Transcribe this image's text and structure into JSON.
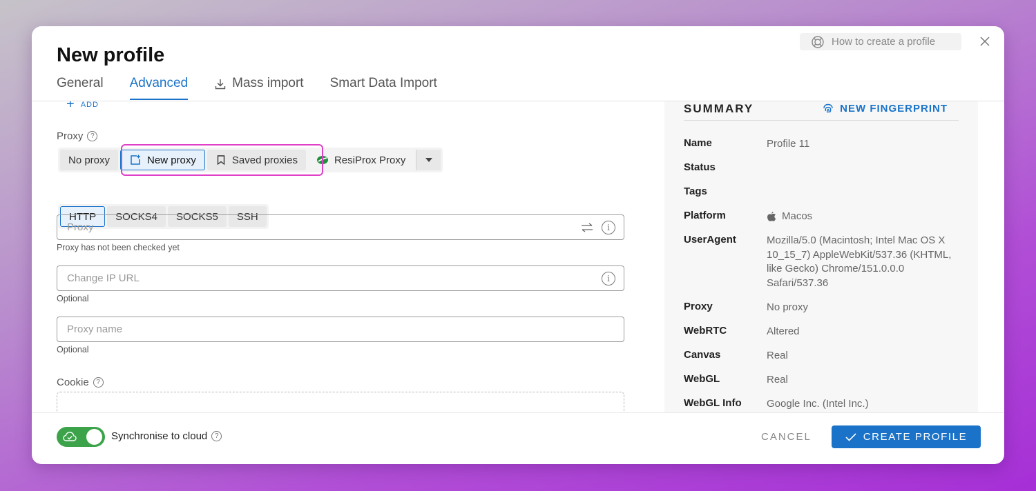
{
  "header": {
    "title": "New profile",
    "help_link": "How to create a profile"
  },
  "tabs": [
    {
      "label": "General"
    },
    {
      "label": "Advanced"
    },
    {
      "label": "Mass import"
    },
    {
      "label": "Smart Data Import"
    }
  ],
  "active_tab": "Advanced",
  "advanced": {
    "add_label": "ADD",
    "proxy_label": "Proxy",
    "proxy_modes": [
      "No proxy",
      "New proxy",
      "Saved proxies",
      "ResiProx Proxy"
    ],
    "active_proxy_mode": "New proxy",
    "protocols": [
      "HTTP",
      "SOCKS4",
      "SOCKS5",
      "SSH"
    ],
    "active_protocol": "HTTP",
    "proxy_field": {
      "placeholder": "Proxy",
      "hint": "Proxy has not been checked yet"
    },
    "change_ip_field": {
      "placeholder": "Change IP URL",
      "hint": "Optional"
    },
    "proxy_name_field": {
      "placeholder": "Proxy name",
      "hint": "Optional"
    },
    "cookie_label": "Cookie"
  },
  "summary": {
    "title": "SUMMARY",
    "fingerprint_button": "NEW FINGERPRINT",
    "rows": [
      {
        "key": "Name",
        "value": "Profile 11"
      },
      {
        "key": "Status",
        "value": ""
      },
      {
        "key": "Tags",
        "value": ""
      },
      {
        "key": "Platform",
        "value": "Macos"
      },
      {
        "key": "UserAgent",
        "value": "Mozilla/5.0 (Macintosh; Intel Mac OS X 10_15_7) AppleWebKit/537.36 (KHTML, like Gecko) Chrome/151.0.0.0 Safari/537.36"
      },
      {
        "key": "Proxy",
        "value": "No proxy"
      },
      {
        "key": "WebRTC",
        "value": "Altered"
      },
      {
        "key": "Canvas",
        "value": "Real"
      },
      {
        "key": "WebGL",
        "value": "Real"
      },
      {
        "key": "WebGL Info",
        "value": "Google Inc. (Intel Inc.)"
      }
    ]
  },
  "footer": {
    "sync_label": "Synchronise to cloud",
    "sync_enabled": true,
    "cancel_label": "CANCEL",
    "create_label": "CREATE PROFILE"
  },
  "colors": {
    "accent": "#1a73c9",
    "toggle_on": "#3ca34a",
    "highlight": "#e040c8"
  }
}
